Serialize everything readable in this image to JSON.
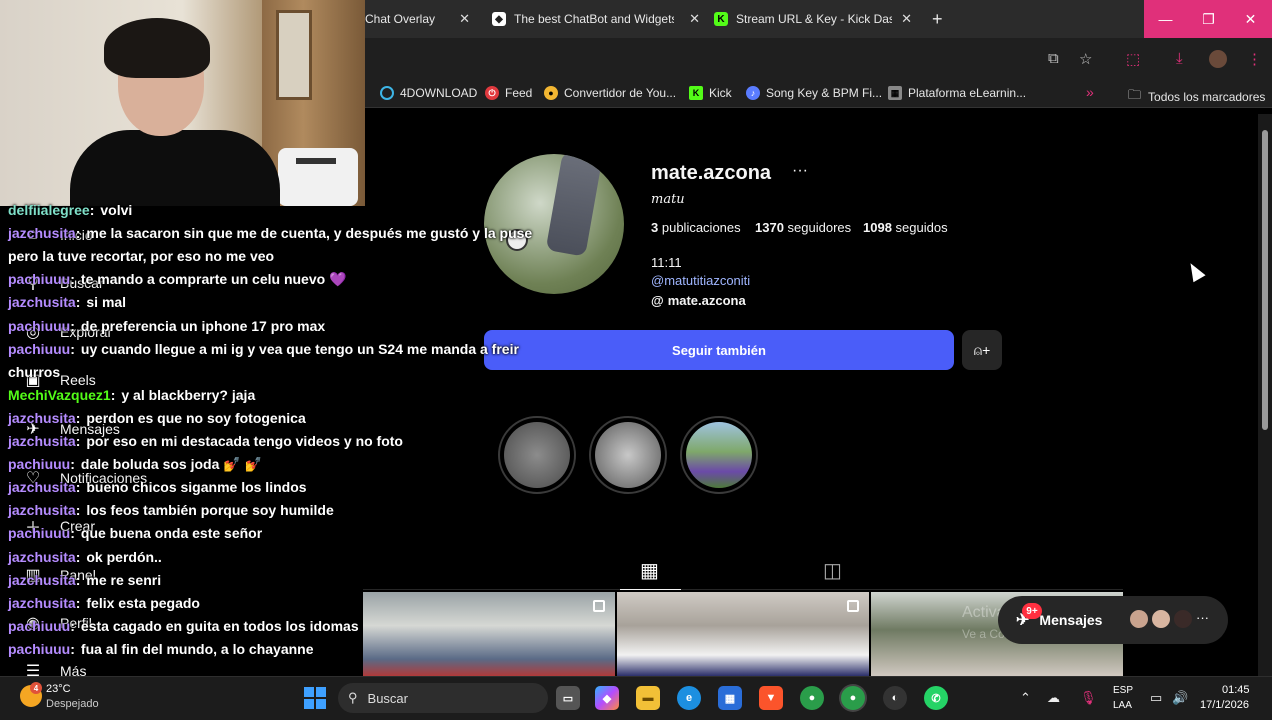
{
  "browser": {
    "tabs": [
      {
        "label": "Chat Overlay",
        "icon": "chat-overlay-icon"
      },
      {
        "label": "The best ChatBot and Widgets",
        "icon": "streamelements-icon"
      },
      {
        "label": "Stream URL & Key - Kick Dashb",
        "icon": "kick-icon"
      }
    ],
    "new_tab": "+",
    "close": "✕",
    "window": {
      "minimize": "—",
      "maximize": "❐",
      "close": "✕"
    },
    "bookmarks": [
      {
        "label": "4DOWNLOAD",
        "color": "#3db5e6"
      },
      {
        "label": "Feed",
        "color": "#e0393e"
      },
      {
        "label": "Convertidor de You...",
        "color": "#f2b632"
      },
      {
        "label": "Kick",
        "color": "#53fc18"
      },
      {
        "label": "Song Key & BPM Fi...",
        "color": "#5a7cff"
      },
      {
        "label": "Plataforma eLearnin...",
        "color": "#888888"
      }
    ],
    "bookmarks_overflow": "»",
    "all_bookmarks": "Todos los marcadores"
  },
  "sidebar": {
    "items": [
      {
        "label": "Inicio",
        "icon": "home-icon"
      },
      {
        "label": "Buscar",
        "icon": "search-icon"
      },
      {
        "label": "Explorar",
        "icon": "compass-icon"
      },
      {
        "label": "Reels",
        "icon": "reels-icon"
      },
      {
        "label": "Mensajes",
        "icon": "messenger-icon"
      },
      {
        "label": "Notificaciones",
        "icon": "heart-icon"
      },
      {
        "label": "Crear",
        "icon": "plus-icon"
      },
      {
        "label": "Panel",
        "icon": "chart-icon"
      },
      {
        "label": "Perfil",
        "icon": "profile-icon"
      },
      {
        "label": "Más",
        "icon": "menu-icon"
      }
    ]
  },
  "profile": {
    "username": "mate.azcona",
    "more": "···",
    "full_name": "matu",
    "posts_count": "3",
    "posts_label": "publicaciones",
    "followers_count": "1370",
    "followers_label": "seguidores",
    "following_count": "1098",
    "following_label": "seguidos",
    "bio_line1": "11:11",
    "bio_mention": "@matutitiazconiti",
    "threads_handle": "mate.azcona",
    "follow_button": "Seguir también",
    "tabs": [
      "posts-grid",
      "tagged"
    ]
  },
  "messages_pill": {
    "label": "Mensajes",
    "badge": "9+"
  },
  "watermark": {
    "line1": "Activar Windows",
    "line2": "Ve a Configuración para activar Windows."
  },
  "chat": [
    {
      "user": "delfiialegree",
      "color": "#7fe0c9",
      "text": "volvi"
    },
    {
      "user": "jazchusita",
      "color": "#b58cff",
      "text": "me la sacaron sin que me de cuenta, y después me gustó y la puse"
    },
    {
      "user": "",
      "color": "#ffffff",
      "text": "pero la tuve recortar, por eso no me veo"
    },
    {
      "user": "pachiuuu",
      "color": "#b58cff",
      "text": "te mando a comprarte un celu nuevo 💜"
    },
    {
      "user": "jazchusita",
      "color": "#b58cff",
      "text": "si mal"
    },
    {
      "user": "pachiuuu",
      "color": "#b58cff",
      "text": "de preferencia un iphone 17 pro max"
    },
    {
      "user": "pachiuuu",
      "color": "#b58cff",
      "text": "uy cuando llegue a mi ig y vea que tengo un S24 me manda a freir"
    },
    {
      "user": "",
      "color": "#ffffff",
      "text": "churros"
    },
    {
      "user": "MechiVazquez1",
      "color": "#53fc18",
      "text": "y al blackberry? jaja"
    },
    {
      "user": "jazchusita",
      "color": "#b58cff",
      "text": "perdon es que no soy fotogenica"
    },
    {
      "user": "jazchusita",
      "color": "#b58cff",
      "text": "por eso en mi destacada tengo videos y no foto"
    },
    {
      "user": "pachiuuu",
      "color": "#b58cff",
      "text": "dale boluda sos joda 💅 💅"
    },
    {
      "user": "jazchusita",
      "color": "#b58cff",
      "text": "bueno chicos siganme los lindos"
    },
    {
      "user": "jazchusita",
      "color": "#b58cff",
      "text": "los feos también porque soy humilde"
    },
    {
      "user": "pachiuuu",
      "color": "#b58cff",
      "text": "que buena onda este señor"
    },
    {
      "user": "jazchusita",
      "color": "#b58cff",
      "text": "ok perdón.."
    },
    {
      "user": "jazchusita",
      "color": "#b58cff",
      "text": "me re senri"
    },
    {
      "user": "jazchusita",
      "color": "#b58cff",
      "text": "felix esta pegado"
    },
    {
      "user": "pachiuuu",
      "color": "#b58cff",
      "text": "esta cagado en guita en todos los idomas"
    },
    {
      "user": "pachiuuu",
      "color": "#b58cff",
      "text": "fua al fin del mundo, a lo chayanne"
    }
  ],
  "taskbar": {
    "temperature": "23°C",
    "weather": "Despejado",
    "weather_badge": "4",
    "search": "Buscar",
    "lang1": "ESP",
    "lang2": "LAA",
    "time": "01:45",
    "date": "17/1/2026"
  }
}
